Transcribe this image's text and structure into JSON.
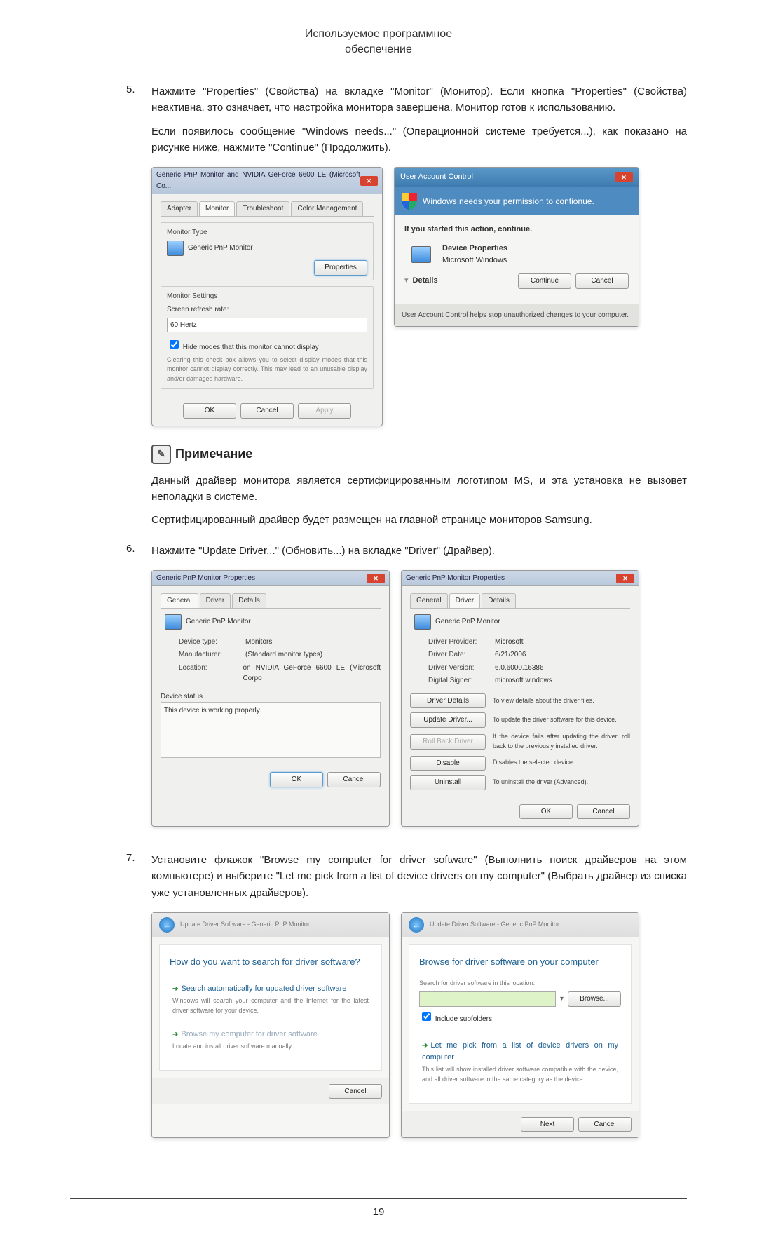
{
  "header": {
    "line1": "Используемое программное",
    "line2": "обеспечение"
  },
  "step5": {
    "num": "5.",
    "p1": "Нажмите \"Properties\" (Свойства) на вкладке \"Monitor\" (Монитор). Если кнопка \"Properties\" (Свойства) неактивна, это означает, что настройка монитора завершена. Монитор готов к использованию.",
    "p2": "Если появилось сообщение \"Windows needs...\" (Операционной системе требуется...), как показано на рисунке ниже, нажмите \"Continue\" (Продолжить)."
  },
  "dlg_monitor": {
    "title": "Generic PnP Monitor and NVIDIA GeForce 6600 LE (Microsoft Co...",
    "tabs": {
      "adapter": "Adapter",
      "monitor": "Monitor",
      "troubleshoot": "Troubleshoot",
      "color": "Color Management"
    },
    "monitor_type": "Monitor Type",
    "device": "Generic PnP Monitor",
    "properties_btn": "Properties",
    "monitor_settings": "Monitor Settings",
    "refresh_label": "Screen refresh rate:",
    "refresh_value": "60 Hertz",
    "hide_modes": "Hide modes that this monitor cannot display",
    "hide_desc": "Clearing this check box allows you to select display modes that this monitor cannot display correctly. This may lead to an unusable display and/or damaged hardware.",
    "ok": "OK",
    "cancel": "Cancel",
    "apply": "Apply"
  },
  "dlg_uac": {
    "title": "User Account Control",
    "headline": "Windows needs your permission to contionue.",
    "started": "If you started this action, continue.",
    "prop": "Device Properties",
    "company": "Microsoft Windows",
    "details": "Details",
    "continue": "Continue",
    "cancel": "Cancel",
    "footer": "User Account Control helps stop unauthorized changes to your computer."
  },
  "note": {
    "heading": "Примечание",
    "p1": "Данный драйвер монитора является сертифицированным логотипом MS, и эта установка не вызовет неполадки в системе.",
    "p2": "Сертифицированный драйвер будет размещен на главной странице мониторов Samsung."
  },
  "step6": {
    "num": "6.",
    "p1": "Нажмите \"Update Driver...\" (Обновить...) на вкладке \"Driver\" (Драйвер)."
  },
  "dlg_general": {
    "title": "Generic PnP Monitor Properties",
    "tabs": {
      "general": "General",
      "driver": "Driver",
      "details": "Details"
    },
    "name": "Generic PnP Monitor",
    "rows": {
      "devtype_l": "Device type:",
      "devtype_v": "Monitors",
      "mfr_l": "Manufacturer:",
      "mfr_v": "(Standard monitor types)",
      "loc_l": "Location:",
      "loc_v": "on NVIDIA GeForce 6600 LE (Microsoft Corpo"
    },
    "status_l": "Device status",
    "status_v": "This device is working properly.",
    "ok": "OK",
    "cancel": "Cancel"
  },
  "dlg_driver": {
    "title": "Generic PnP Monitor Properties",
    "tabs": {
      "general": "General",
      "driver": "Driver",
      "details": "Details"
    },
    "name": "Generic PnP Monitor",
    "rows": {
      "prov_l": "Driver Provider:",
      "prov_v": "Microsoft",
      "date_l": "Driver Date:",
      "date_v": "6/21/2006",
      "ver_l": "Driver Version:",
      "ver_v": "6.0.6000.16386",
      "sig_l": "Digital Signer:",
      "sig_v": "microsoft windows"
    },
    "btn_details": "Driver Details",
    "desc_details": "To view details about the driver files.",
    "btn_update": "Update Driver...",
    "desc_update": "To update the driver software for this device.",
    "btn_rollback": "Roll Back Driver",
    "desc_rollback": "If the device fails after updating the driver, roll back to the previously installed driver.",
    "btn_disable": "Disable",
    "desc_disable": "Disables the selected device.",
    "btn_uninstall": "Uninstall",
    "desc_uninstall": "To uninstall the driver (Advanced).",
    "ok": "OK",
    "cancel": "Cancel"
  },
  "step7": {
    "num": "7.",
    "p1": "Установите флажок \"Browse my computer for driver software\" (Выполнить поиск драйверов на этом компьютере) и выберите \"Let me pick from a list of device drivers on my computer\" (Выбрать драйвер из списка уже установленных драйверов)."
  },
  "wiz1": {
    "crumb": "Update Driver Software - Generic PnP Monitor",
    "title": "How do you want to search for driver software?",
    "opt1_t": "Search automatically for updated driver software",
    "opt1_d": "Windows will search your computer and the Internet for the latest driver software for your device.",
    "opt2_t": "Browse my computer for driver software",
    "opt2_d": "Locate and install driver software manually.",
    "cancel": "Cancel"
  },
  "wiz2": {
    "crumb": "Update Driver Software - Generic PnP Monitor",
    "title": "Browse for driver software on your computer",
    "search_l": "Search for driver software in this location:",
    "browse": "Browse...",
    "include": "Include subfolders",
    "opt_t": "Let me pick from a list of device drivers on my computer",
    "opt_d": "This list will show installed driver software compatible with the device, and all driver software in the same category as the device.",
    "next": "Next",
    "cancel": "Cancel"
  },
  "page_num": "19"
}
